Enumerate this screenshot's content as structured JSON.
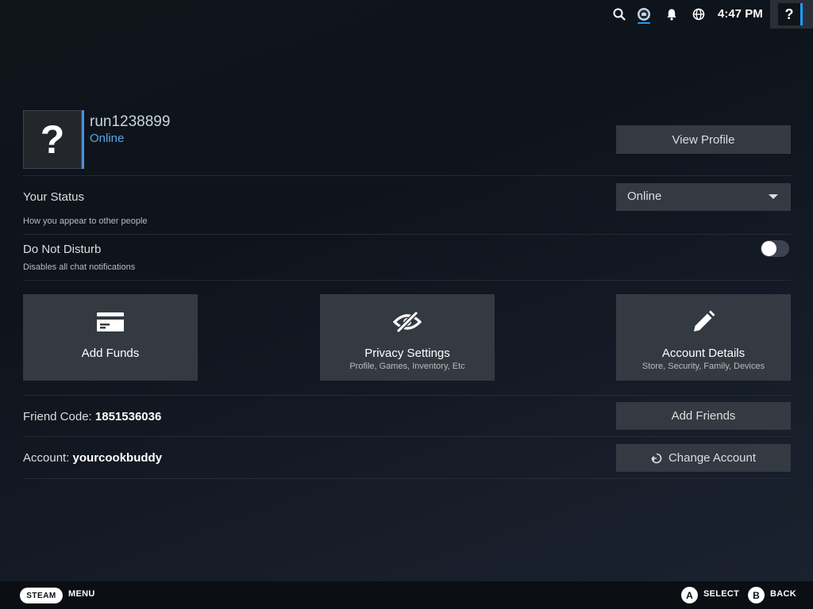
{
  "topbar": {
    "icons": [
      "search-icon",
      "steam-chat-icon",
      "bell-icon",
      "globe-icon"
    ],
    "time": "4:47 PM",
    "help_label": "?"
  },
  "profile": {
    "avatar_glyph": "?",
    "username": "run1238899",
    "status": "Online",
    "view_profile_label": "View Profile"
  },
  "your_status": {
    "label": "Your Status",
    "description": "How you appear to other people",
    "selected": "Online"
  },
  "do_not_disturb": {
    "label": "Do Not Disturb",
    "description": "Disables all chat notifications",
    "enabled": false
  },
  "tiles": [
    {
      "icon": "credit-card-icon",
      "title": "Add Funds",
      "subtitle": ""
    },
    {
      "icon": "eye-off-icon",
      "title": "Privacy Settings",
      "subtitle": "Profile, Games, Inventory, Etc"
    },
    {
      "icon": "pencil-icon",
      "title": "Account Details",
      "subtitle": "Store, Security, Family, Devices"
    }
  ],
  "friend_code": {
    "label": "Friend Code:",
    "value": "1851536036",
    "button": "Add Friends"
  },
  "account": {
    "label": "Account:",
    "value": "yourcookbuddy",
    "button": "Change Account"
  },
  "footer": {
    "steam_label": "STEAM",
    "menu_label": "MENU",
    "a_glyph": "A",
    "select_label": "SELECT",
    "b_glyph": "B",
    "back_label": "BACK"
  },
  "colors": {
    "accent": "#1a9fff",
    "status_online": "#57a8e6",
    "button_bg": "#343a42"
  }
}
